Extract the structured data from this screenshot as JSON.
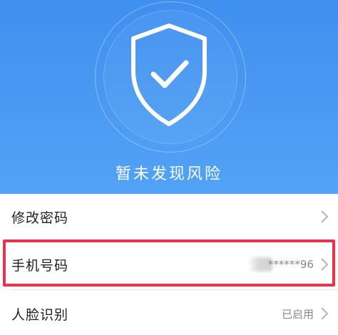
{
  "hero": {
    "status_text": "暂未发现风险",
    "icon": "shield-check-icon"
  },
  "list": {
    "items": [
      {
        "label": "修改密码",
        "value": ""
      },
      {
        "label": "手机号码",
        "value": "******96"
      },
      {
        "label": "人脸识别",
        "value": "已启用"
      }
    ]
  },
  "colors": {
    "hero_top": "#3f8ff0",
    "hero_bottom": "#52a3f6",
    "highlight_border": "#e8334a"
  }
}
